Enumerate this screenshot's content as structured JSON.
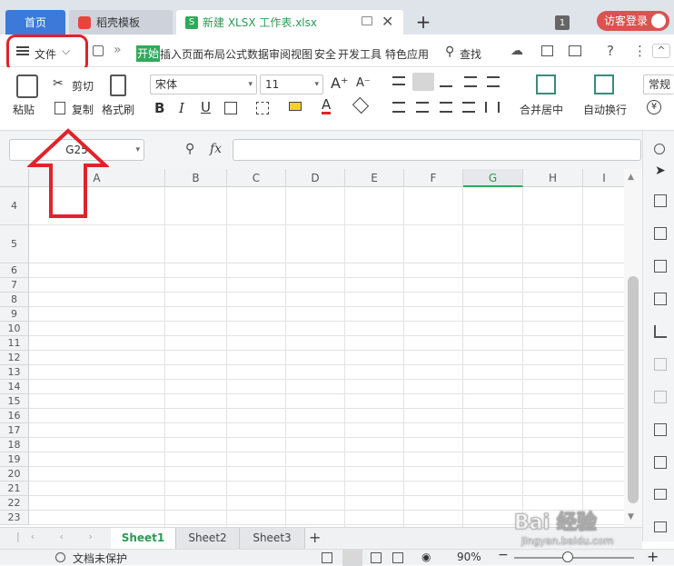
{
  "titlebar": {
    "tabs": [
      {
        "label": "首页"
      },
      {
        "label": "稻壳模板"
      },
      {
        "label": "新建 XLSX 工作表.xlsx"
      }
    ],
    "new_tab_symbol": "+",
    "window_count": "1",
    "login_label": "访客登录"
  },
  "menu": {
    "file_label": "文件",
    "tabs": [
      "开始",
      "插入",
      "页面布局",
      "公式",
      "数据",
      "审阅",
      "视图",
      "安全",
      "开发工具",
      "特色应用"
    ],
    "search_label": "查找"
  },
  "ribbon": {
    "paste_label": "粘贴",
    "cut_label": "剪切",
    "copy_label": "复制",
    "format_painter_label": "格式刷",
    "font_name": "宋体",
    "font_size": "11",
    "bold": "B",
    "italic": "I",
    "underline": "U",
    "merge_center_label": "合并居中",
    "wrap_text_label": "自动换行",
    "number_format": "常规"
  },
  "formula_bar": {
    "cell_ref": "G25",
    "fx_label": "fx",
    "value": ""
  },
  "grid": {
    "columns": [
      "A",
      "B",
      "C",
      "D",
      "E",
      "F",
      "G",
      "H",
      "I"
    ],
    "selected_column": "G",
    "rows": [
      "4",
      "5",
      "6",
      "7",
      "8",
      "9",
      "10",
      "11",
      "12",
      "13",
      "14",
      "15",
      "16",
      "17",
      "18",
      "19",
      "20",
      "21",
      "22",
      "23"
    ]
  },
  "sheets": {
    "tabs": [
      "Sheet1",
      "Sheet2",
      "Sheet3"
    ],
    "active": "Sheet1",
    "add_symbol": "+"
  },
  "status": {
    "protect_label": "文档未保护",
    "zoom": "90%",
    "zoom_level": 0.45
  },
  "colors": {
    "accent_blue": "#3c79d8",
    "wps_green": "#2eaa5b",
    "annotation_red": "#e0232a",
    "login_red": "#d9534f"
  },
  "watermark": "Baidu经验 jingyan.baidu.com"
}
